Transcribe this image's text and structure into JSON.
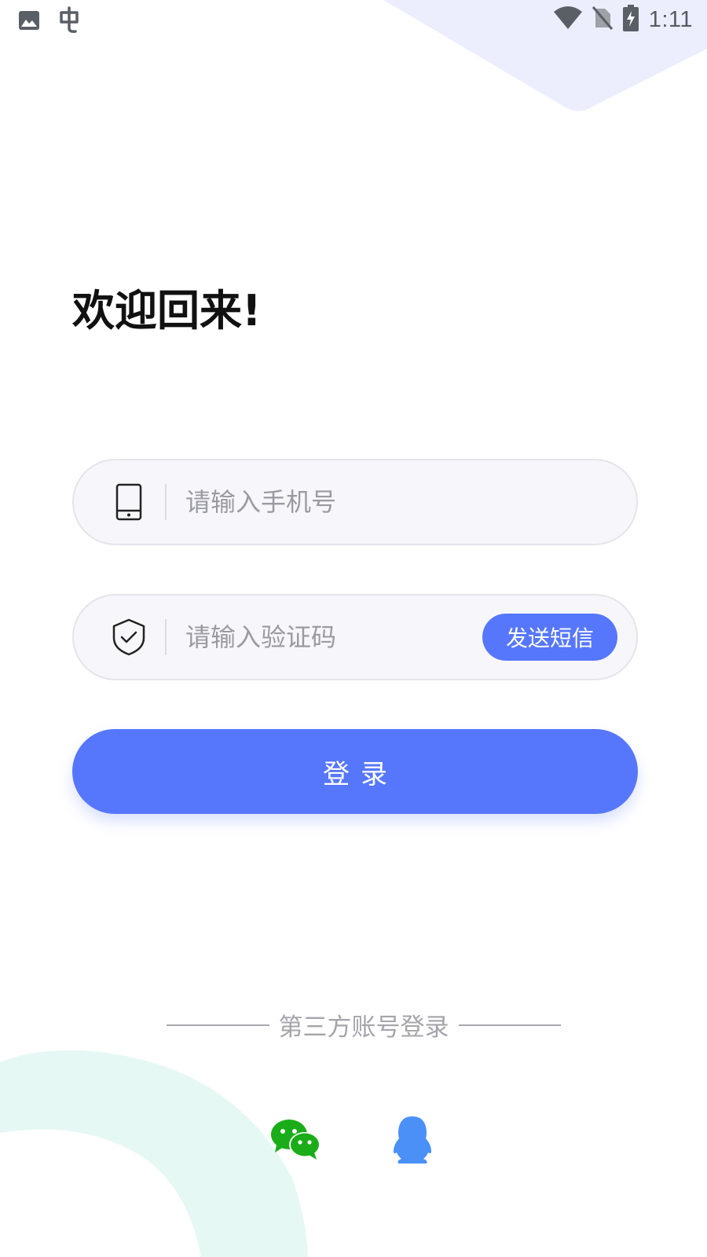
{
  "status_bar": {
    "time": "1:11",
    "left_icons": [
      "gallery-icon",
      "bug-icon"
    ],
    "right_icons": [
      "wifi-icon",
      "no-sim-icon",
      "battery-charging-icon"
    ]
  },
  "login": {
    "title": "欢迎回来!",
    "phone": {
      "icon": "phone-icon",
      "value": "",
      "placeholder": "请输入手机号"
    },
    "code": {
      "icon": "shield-check-icon",
      "value": "",
      "placeholder": "请输入验证码",
      "send_label": "发送短信"
    },
    "submit_label": "登录"
  },
  "third_party": {
    "label": "第三方账号登录",
    "providers": [
      {
        "name": "WeChat",
        "icon": "wechat-icon",
        "color": "#1aad19"
      },
      {
        "name": "QQ",
        "icon": "qq-icon",
        "color": "#4a90f7"
      }
    ]
  },
  "colors": {
    "accent": "#5677fc",
    "input_bg": "#f7f7fb",
    "input_border": "#e4e4ea",
    "deco_top": "#eceefd",
    "deco_bottom": "#e6f8f4"
  }
}
